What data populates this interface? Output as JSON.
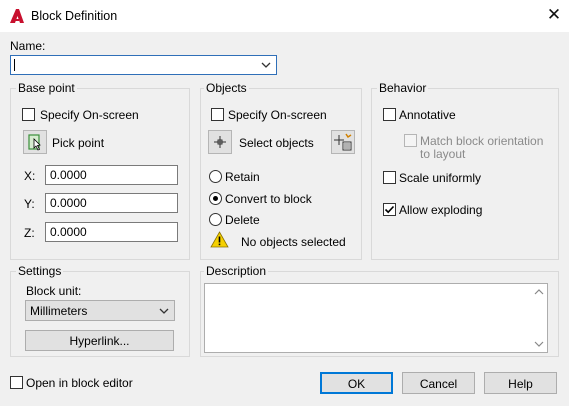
{
  "window": {
    "title": "Block Definition",
    "icons": {
      "app": "autocad-a-icon",
      "close": "close-icon"
    },
    "close_glyph": "✕"
  },
  "name": {
    "label": "Name:",
    "value": ""
  },
  "base_point": {
    "title": "Base point",
    "specify_on_screen": {
      "label": "Specify On-screen",
      "checked": false
    },
    "pick_point": {
      "label": "Pick point",
      "icon": "pick-point-icon"
    },
    "x": {
      "label": "X:",
      "value": "0.0000"
    },
    "y": {
      "label": "Y:",
      "value": "0.0000"
    },
    "z": {
      "label": "Z:",
      "value": "0.0000"
    }
  },
  "objects": {
    "title": "Objects",
    "specify_on_screen": {
      "label": "Specify On-screen",
      "checked": false
    },
    "select_objects": {
      "label": "Select objects",
      "icon": "select-objects-icon"
    },
    "quick_select_icon": "quick-select-icon",
    "retain": {
      "label": "Retain",
      "selected": false
    },
    "convert_to_block": {
      "label": "Convert to block",
      "selected": true
    },
    "delete": {
      "label": "Delete",
      "selected": false
    },
    "status": {
      "text": "No objects selected",
      "icon": "warning-icon"
    }
  },
  "behavior": {
    "title": "Behavior",
    "annotative": {
      "label": "Annotative",
      "checked": false
    },
    "match_orientation": {
      "label_line1": "Match block orientation",
      "label_line2": "to layout",
      "checked": false,
      "enabled": false
    },
    "scale_uniformly": {
      "label": "Scale uniformly",
      "checked": false
    },
    "allow_exploding": {
      "label": "Allow exploding",
      "checked": true
    }
  },
  "settings": {
    "title": "Settings",
    "block_unit_label": "Block unit:",
    "block_unit_value": "Millimeters",
    "hyperlink_label": "Hyperlink..."
  },
  "description": {
    "title": "Description",
    "value": ""
  },
  "footer": {
    "open_in_block_editor": {
      "label": "Open in block editor",
      "checked": false
    },
    "ok_label": "OK",
    "cancel_label": "Cancel",
    "help_label": "Help"
  },
  "colors": {
    "accent": "#0078d7",
    "app_icon_red": "#c8102e",
    "warning_yellow": "#f5d000",
    "pick_icon_green": "#3a8f3a"
  }
}
